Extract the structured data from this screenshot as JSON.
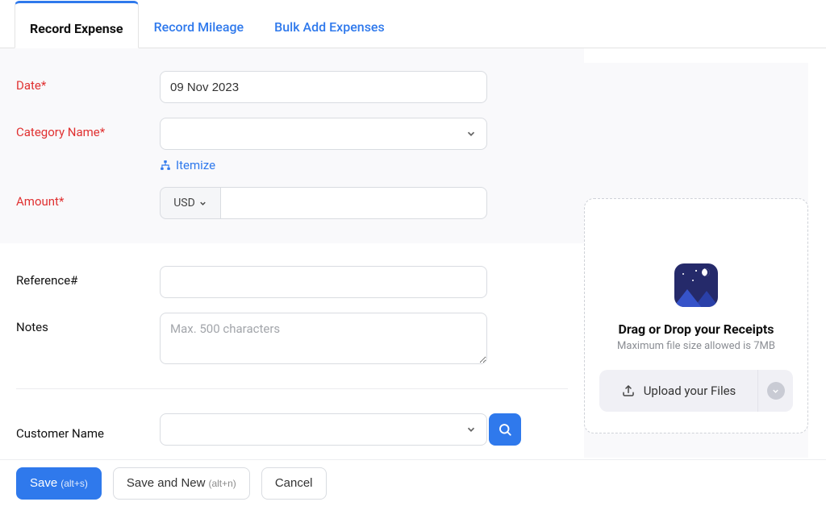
{
  "tabs": {
    "record_expense": "Record Expense",
    "record_mileage": "Record Mileage",
    "bulk_add": "Bulk Add Expenses"
  },
  "form": {
    "date_label": "Date*",
    "date_value": "09 Nov 2023",
    "category_label": "Category Name*",
    "category_value": "",
    "itemize": "Itemize",
    "amount_label": "Amount*",
    "currency": "USD",
    "amount_value": "",
    "reference_label": "Reference#",
    "reference_value": "",
    "notes_label": "Notes",
    "notes_placeholder": "Max. 500 characters",
    "customer_label": "Customer Name",
    "customer_value": ""
  },
  "dropzone": {
    "title": "Drag or Drop your Receipts",
    "subtitle": "Maximum file size allowed is 7MB",
    "upload_label": "Upload your Files"
  },
  "footer": {
    "save_label": "Save",
    "save_shortcut": "(alt+s)",
    "save_new_label": "Save and New",
    "save_new_shortcut": "(alt+n)",
    "cancel_label": "Cancel"
  }
}
